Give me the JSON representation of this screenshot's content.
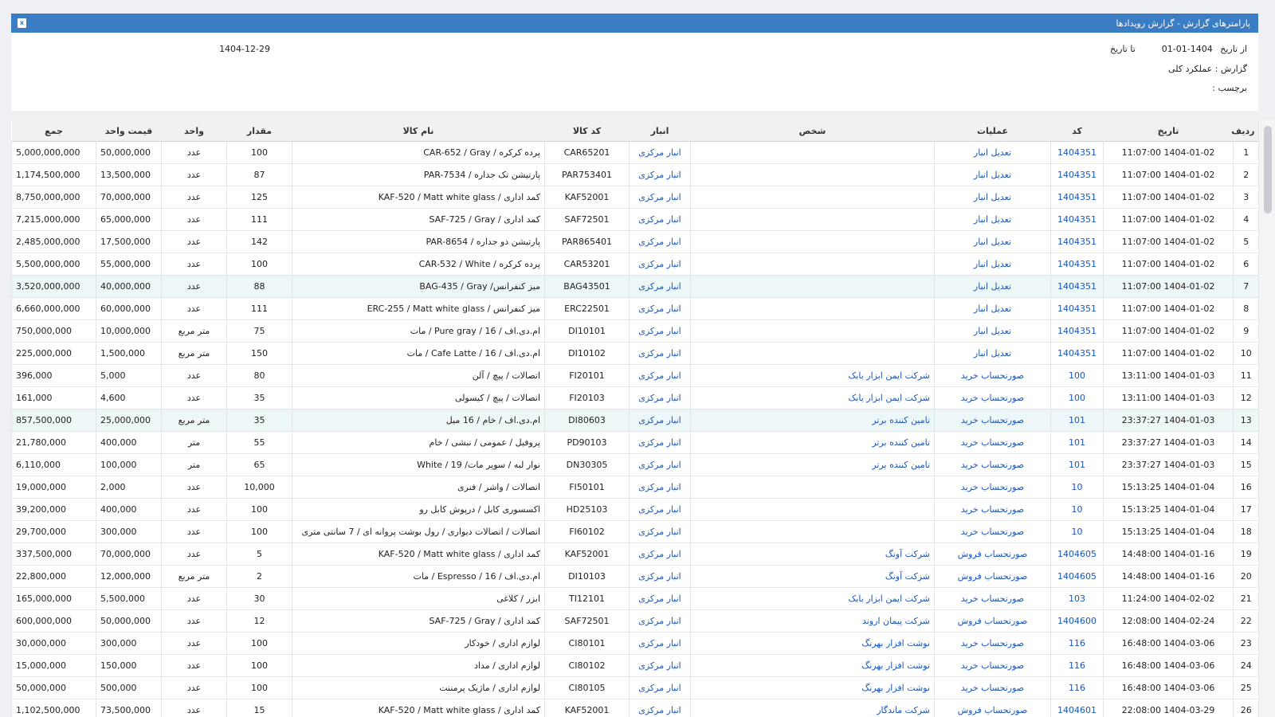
{
  "header": {
    "title": "پارامترهای گزارش - گزارش رویدادها",
    "export_icon": "excel-icon",
    "export_glyph": "x"
  },
  "params": {
    "from_label": "از تاریخ",
    "from_value": "1404-01-01",
    "to_label": "تا تاریخ",
    "to_value": "1404-12-29",
    "report_label": "گزارش : عملکرد کلی",
    "tag_label": "برچسب :"
  },
  "columns": [
    "ردیف",
    "تاریخ",
    "کد",
    "عملیات",
    "شخص",
    "انبار",
    "کد کالا",
    "نام کالا",
    "مقدار",
    "واحد",
    "قیمت واحد",
    "جمع"
  ],
  "rows": [
    [
      "1",
      "1404-01-02 11:07:00",
      "1404351",
      "تعدیل انبار",
      "",
      "انبار مرکزی",
      "CAR65201",
      "پرده کرکره / CAR-652 / Gray",
      "100",
      "عدد",
      "50,000,000",
      "5,000,000,000"
    ],
    [
      "2",
      "1404-01-02 11:07:00",
      "1404351",
      "تعدیل انبار",
      "",
      "انبار مرکزی",
      "PAR753401",
      "پارتیشن تک جداره / PAR-7534",
      "87",
      "عدد",
      "13,500,000",
      "1,174,500,000"
    ],
    [
      "3",
      "1404-01-02 11:07:00",
      "1404351",
      "تعدیل انبار",
      "",
      "انبار مرکزی",
      "KAF52001",
      "کمد اداری / KAF-520 / Matt white glass",
      "125",
      "عدد",
      "70,000,000",
      "8,750,000,000"
    ],
    [
      "4",
      "1404-01-02 11:07:00",
      "1404351",
      "تعدیل انبار",
      "",
      "انبار مرکزی",
      "SAF72501",
      "کمد اداری / SAF-725 / Gray",
      "111",
      "عدد",
      "65,000,000",
      "7,215,000,000"
    ],
    [
      "5",
      "1404-01-02 11:07:00",
      "1404351",
      "تعدیل انبار",
      "",
      "انبار مرکزی",
      "PAR865401",
      "پارتیشن دو جداره / PAR-8654",
      "142",
      "عدد",
      "17,500,000",
      "2,485,000,000"
    ],
    [
      "6",
      "1404-01-02 11:07:00",
      "1404351",
      "تعدیل انبار",
      "",
      "انبار مرکزی",
      "CAR53201",
      "پرده کرکره / CAR-532 / White",
      "100",
      "عدد",
      "55,000,000",
      "5,500,000,000"
    ],
    [
      "7",
      "1404-01-02 11:07:00",
      "1404351",
      "تعدیل انبار",
      "",
      "انبار مرکزی",
      "BAG43501",
      "میز کنفرانس/ BAG-435 / Gray",
      "88",
      "عدد",
      "40,000,000",
      "3,520,000,000"
    ],
    [
      "8",
      "1404-01-02 11:07:00",
      "1404351",
      "تعدیل انبار",
      "",
      "انبار مرکزی",
      "ERC22501",
      "میز کنفرانس / ERC-255 / Matt white glass",
      "111",
      "عدد",
      "60,000,000",
      "6,660,000,000"
    ],
    [
      "9",
      "1404-01-02 11:07:00",
      "1404351",
      "تعدیل انبار",
      "",
      "انبار مرکزی",
      "DI10101",
      "ام.دی.اف / 16 / Pure gray / مات",
      "75",
      "متر مربع",
      "10,000,000",
      "750,000,000"
    ],
    [
      "10",
      "1404-01-02 11:07:00",
      "1404351",
      "تعدیل انبار",
      "",
      "انبار مرکزی",
      "DI10102",
      "ام.دی.اف / 16 / Cafe Latte / مات",
      "150",
      "متر مربع",
      "1,500,000",
      "225,000,000"
    ],
    [
      "11",
      "1404-01-03 13:11:00",
      "100",
      "صورتحساب خرید",
      "شرکت ایمن ابزار بابک",
      "انبار مرکزی",
      "FI20101",
      "اتصالات / پیچ / آلن",
      "80",
      "عدد",
      "5,000",
      "396,000"
    ],
    [
      "12",
      "1404-01-03 13:11:00",
      "100",
      "صورتحساب خرید",
      "شرکت ایمن ابزار بابک",
      "انبار مرکزی",
      "FI20103",
      "اتصالات / پیچ / کیسولی",
      "35",
      "عدد",
      "4,600",
      "161,000"
    ],
    [
      "13",
      "1404-01-03 23:37:27",
      "101",
      "صورتحساب خرید",
      "تامین کننده برتر",
      "انبار مرکزی",
      "DI80603",
      "ام.دی.اف / خام / 16 میل",
      "35",
      "متر مربع",
      "25,000,000",
      "857,500,000"
    ],
    [
      "14",
      "1404-01-03 23:37:27",
      "101",
      "صورتحساب خرید",
      "تامین کننده برتر",
      "انبار مرکزی",
      "PD90103",
      "پروفیل / عمومی / نبشی / خام",
      "55",
      "متر",
      "400,000",
      "21,780,000"
    ],
    [
      "15",
      "1404-01-03 23:37:27",
      "101",
      "صورتحساب خرید",
      "تامین کننده برتر",
      "انبار مرکزی",
      "DN30305",
      "نوار لبه / سوپر مات/ 19 / White",
      "65",
      "متر",
      "100,000",
      "6,110,000"
    ],
    [
      "16",
      "1404-01-04 15:13:25",
      "10",
      "صورتحساب خرید",
      "",
      "انبار مرکزی",
      "FI50101",
      "اتصالات / واشر / فنری",
      "10,000",
      "عدد",
      "2,000",
      "19,000,000"
    ],
    [
      "17",
      "1404-01-04 15:13:25",
      "10",
      "صورتحساب خرید",
      "",
      "انبار مرکزی",
      "HD25103",
      "اکسسوری کابل / درپوش کابل رو",
      "100",
      "عدد",
      "400,000",
      "39,200,000"
    ],
    [
      "18",
      "1404-01-04 15:13:25",
      "10",
      "صورتحساب خرید",
      "",
      "انبار مرکزی",
      "FI60102",
      "اتصالات / اتصالات دیواری / رول بوشت پروانه ای / 7 سانتی متری",
      "100",
      "عدد",
      "300,000",
      "29,700,000"
    ],
    [
      "19",
      "1404-01-16 14:48:00",
      "1404605",
      "صورتحساب فروش",
      "شرکت آونگ",
      "انبار مرکزی",
      "KAF52001",
      "کمد اداری / KAF-520 / Matt white glass",
      "5",
      "عدد",
      "70,000,000",
      "337,500,000"
    ],
    [
      "20",
      "1404-01-16 14:48:00",
      "1404605",
      "صورتحساب فروش",
      "شرکت آونگ",
      "انبار مرکزی",
      "DI10103",
      "ام.دی.اف / 16 / Espresso / مات",
      "2",
      "متر مربع",
      "12,000,000",
      "22,800,000"
    ],
    [
      "21",
      "1404-02-02 11:24:00",
      "103",
      "صورتحساب خرید",
      "شرکت ایمن ابزار بابک",
      "انبار مرکزی",
      "TI12101",
      "ابزر / کلاغی",
      "30",
      "عدد",
      "5,500,000",
      "165,000,000"
    ],
    [
      "22",
      "1404-02-24 12:08:00",
      "1404600",
      "صورتحساب فروش",
      "شرکت پیمان اروند",
      "انبار مرکزی",
      "SAF72501",
      "کمد اداری / SAF-725 / Gray",
      "12",
      "عدد",
      "50,000,000",
      "600,000,000"
    ],
    [
      "23",
      "1404-03-06 16:48:00",
      "116",
      "صورتحساب خرید",
      "نوشت افزار بهرنگ",
      "انبار مرکزی",
      "CI80101",
      "لوازم اداری / خودکار",
      "100",
      "عدد",
      "300,000",
      "30,000,000"
    ],
    [
      "24",
      "1404-03-06 16:48:00",
      "116",
      "صورتحساب خرید",
      "نوشت افزار بهرنگ",
      "انبار مرکزی",
      "CI80102",
      "لوازم اداری / مداد",
      "100",
      "عدد",
      "150,000",
      "15,000,000"
    ],
    [
      "25",
      "1404-03-06 16:48:00",
      "116",
      "صورتحساب خرید",
      "نوشت افزار بهرنگ",
      "انبار مرکزی",
      "CI80105",
      "لوازم اداری / ماژیک پرمننت",
      "100",
      "عدد",
      "500,000",
      "50,000,000"
    ],
    [
      "26",
      "1404-03-29 22:08:00",
      "1404601",
      "صورتحساب فروش",
      "شرکت ماندگار",
      "انبار مرکزی",
      "KAF52001",
      "کمد اداری / KAF-520 / Matt white glass",
      "15",
      "عدد",
      "73,500,000",
      "1,102,500,000"
    ]
  ],
  "highlighted_rows": [
    7,
    13
  ],
  "colors": {
    "header": "#3b7dc4",
    "link": "#1b55b8",
    "highlight": "#eef7f8"
  }
}
